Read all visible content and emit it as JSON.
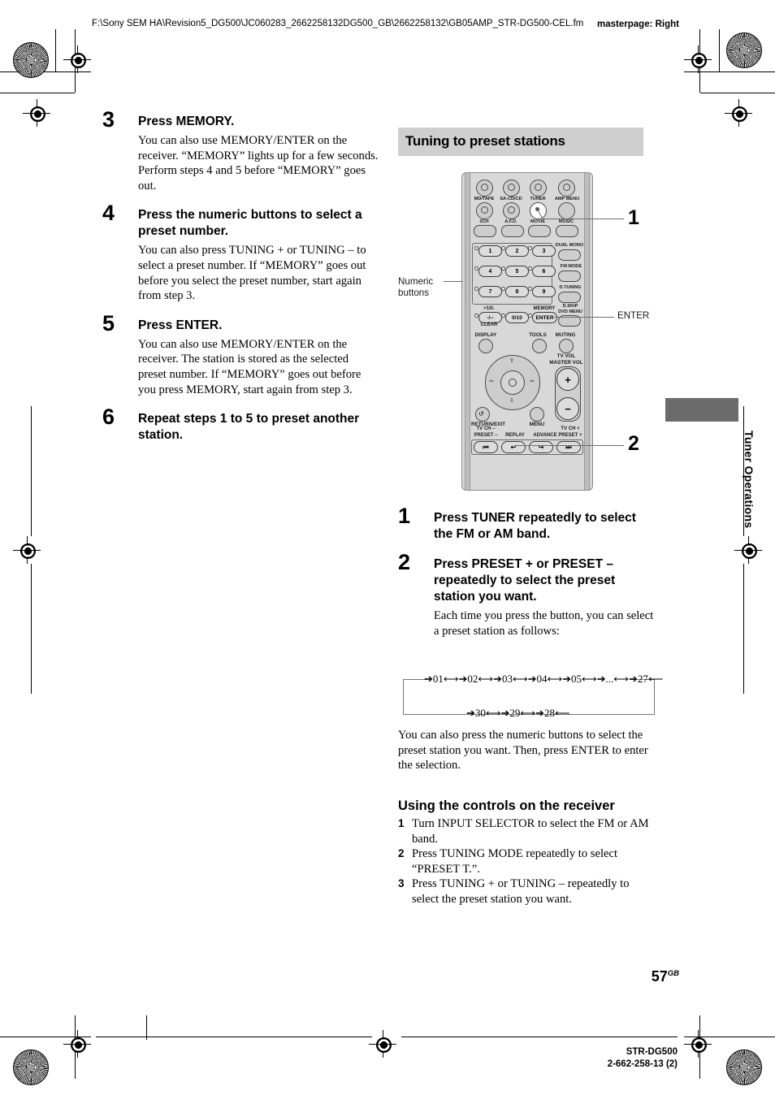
{
  "header": {
    "file_path": "F:\\Sony SEM HA\\Revision5_DG500\\JC060283_2662258132DG500_GB\\2662258132\\GB05AMP_STR-DG500-CEL.fm",
    "masterpage": "masterpage: Right"
  },
  "left_column": {
    "steps": [
      {
        "num": "3",
        "heading": "Press MEMORY.",
        "body": "You can also use MEMORY/ENTER on the receiver. “MEMORY” lights up for a few seconds. Perform steps 4 and 5 before “MEMORY” goes out."
      },
      {
        "num": "4",
        "heading": "Press the numeric buttons to select a preset number.",
        "body": "You can also press TUNING + or TUNING – to select a preset number. If “MEMORY” goes out before you select the preset number, start again from step 3."
      },
      {
        "num": "5",
        "heading": "Press ENTER.",
        "body": "You can also use MEMORY/ENTER on the receiver. The station is stored as the selected preset number. If “MEMORY” goes out before you press MEMORY, start again from step 3."
      },
      {
        "num": "6",
        "heading": "Repeat steps 1 to 5 to preset another station.",
        "body": ""
      }
    ]
  },
  "right_column": {
    "section_title": "Tuning to preset stations",
    "steps": [
      {
        "num": "1",
        "heading": "Press TUNER repeatedly to select the FM or AM band.",
        "body": ""
      },
      {
        "num": "2",
        "heading": "Press PRESET + or PRESET – repeatedly to select the preset station you want.",
        "body": "Each time you press the button, you can select a preset station as follows:"
      }
    ],
    "after_diagram": "You can also press the numeric buttons to select the preset station you want. Then, press ENTER to enter the selection.",
    "subsection": {
      "title": "Using the controls on the receiver",
      "items": [
        {
          "num": "1",
          "text": "Turn INPUT SELECTOR to select the FM or AM band."
        },
        {
          "num": "2",
          "text": "Press TUNING MODE repeatedly to select “PRESET T.”."
        },
        {
          "num": "3",
          "text": "Press TUNING + or TUNING – repeatedly to select the preset station you want."
        }
      ]
    }
  },
  "cycle_diagram": {
    "top_sequence": "01  02  03  04  05  ...  27",
    "top_items": [
      "01",
      "02",
      "03",
      "04",
      "05",
      "...",
      "27"
    ],
    "bottom_items": [
      "30",
      "29",
      "28"
    ],
    "bottom_sequence": "30  29  28"
  },
  "remote": {
    "callout_1": "1",
    "callout_2": "2",
    "label_numeric_buttons": "Numeric\nbuttons",
    "label_numeric_line1": "Numeric",
    "label_numeric_line2": "buttons",
    "label_enter": "ENTER",
    "row1_labels": [
      "MD/TAPE",
      "SA-CD/CD",
      "TUNER",
      "AMP MENU"
    ],
    "row2_labels": [
      "2CH",
      "A.F.D.",
      "MOVIE",
      "MUSIC"
    ],
    "keypad": [
      "1",
      "2",
      "3",
      "4",
      "5",
      "6",
      "7",
      "8",
      "9"
    ],
    "key_10_top": ">10/.",
    "key_10_main": "-/--",
    "key_10_sub": "CLEAR",
    "key_zero": "0/10",
    "key_memory_top": "MEMORY",
    "key_memory_main": "ENTER",
    "side_labels": [
      "DUAL MONO",
      "FM MODE",
      "D.TUNING",
      "D.SKIP",
      "DVD MENU"
    ],
    "display_label": "DISPLAY",
    "tools_label": "TOOLS",
    "muting_label": "MUTING",
    "tv_vol_label": "TV VOL",
    "master_vol_label": "MASTER VOL",
    "vol_plus": "+",
    "vol_minus": "−",
    "return_label": "RETURN/EXIT",
    "menu_label": "MENU",
    "bottom_labels": {
      "tv_ch_minus": "TV CH –",
      "preset_minus": "PRESET –",
      "replay": "REPLAY",
      "advance": "ADVANCE",
      "tv_ch_plus": "TV CH +",
      "preset_plus": "PRESET +"
    },
    "bottom_glyphs": [
      "⏮",
      "↩",
      "↪",
      "⏭"
    ]
  },
  "side_tab": {
    "label": "Tuner Operations"
  },
  "footer": {
    "page_number": "57",
    "page_suffix": "GB",
    "model": "STR-DG500",
    "doc_number_pre": "2-662-258-",
    "doc_number_bold": "13",
    "doc_number_post": " (2)"
  }
}
